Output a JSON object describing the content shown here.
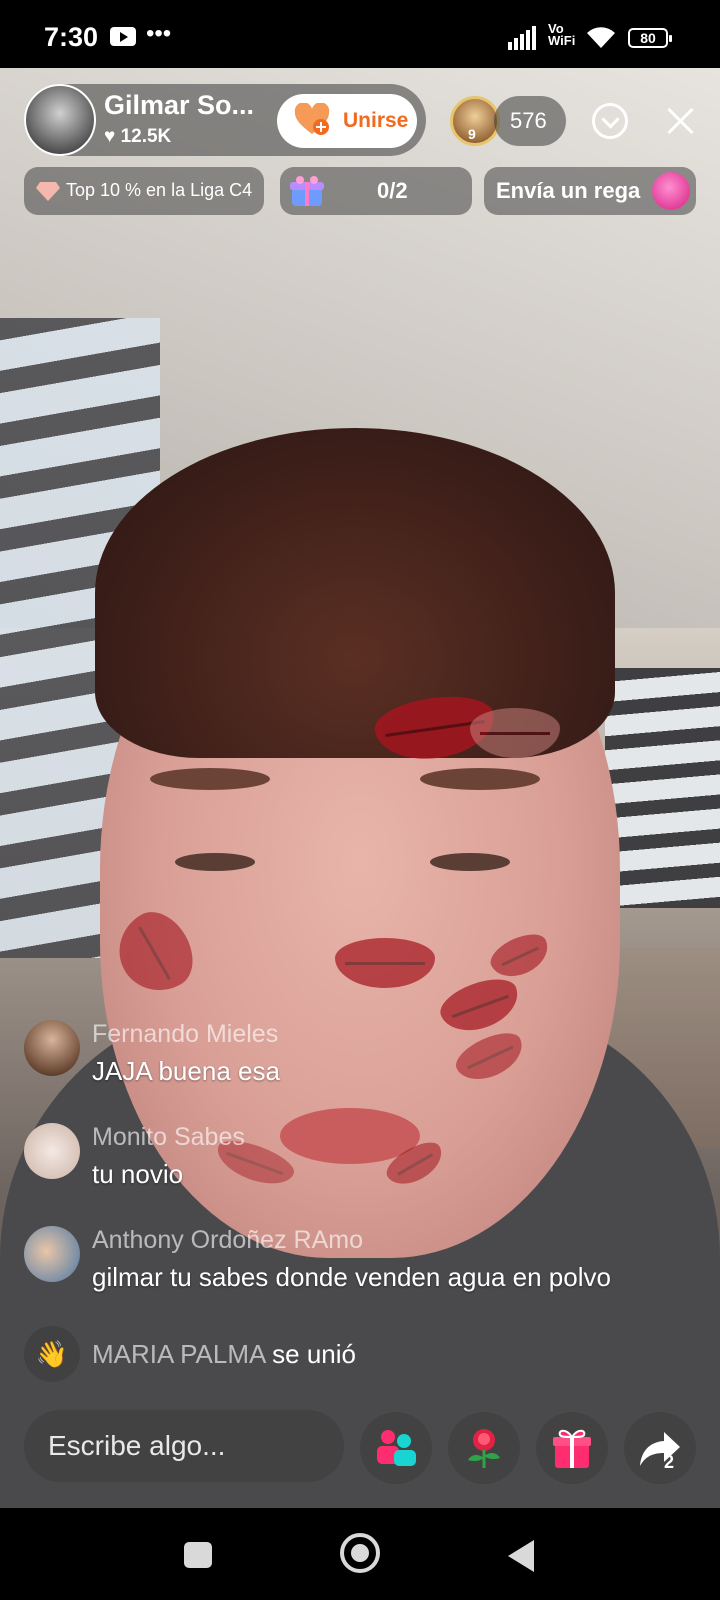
{
  "status_bar": {
    "time": "7:30",
    "more": "•••",
    "network_label": "Vo\nWiFi",
    "battery": "80"
  },
  "host": {
    "name": "Gilmar So...",
    "likes": "12.5K",
    "join_label": "Unirse"
  },
  "viewers": {
    "badge_level": "9",
    "count": "576"
  },
  "chips": {
    "league": "Top 10 % en la Liga C4",
    "goal": "0/2",
    "gift_prompt": "Envía un rega"
  },
  "comments": [
    {
      "user": "Fernando Mieles",
      "text": "JAJA buena esa"
    },
    {
      "user": "Monito Sabes",
      "text": "tu novio"
    },
    {
      "user": "Anthony Ordoñez RAmo",
      "text": "gilmar tu sabes donde venden agua en polvo"
    }
  ],
  "join_event": {
    "user": "MARIA PALMA",
    "text": "se unió"
  },
  "composer": {
    "placeholder": "Escribe algo..."
  },
  "actions": {
    "share_count": "2"
  },
  "icons": {
    "join": "heart-plus-icon",
    "collapse": "chevron-down-circle-icon",
    "close": "close-icon",
    "league": "diamond-icon",
    "goal": "gift-box-icon",
    "gift_prompt": "octopus-gift-icon",
    "wave": "wave-hand-icon",
    "guests": "multi-guest-icon",
    "rose": "rose-icon",
    "gift": "gift-icon",
    "share": "share-arrow-icon"
  },
  "colors": {
    "join_accent": "#f26a1f",
    "gift_accent": "#ff2d6f",
    "guest_accent": "#19d4d0"
  }
}
